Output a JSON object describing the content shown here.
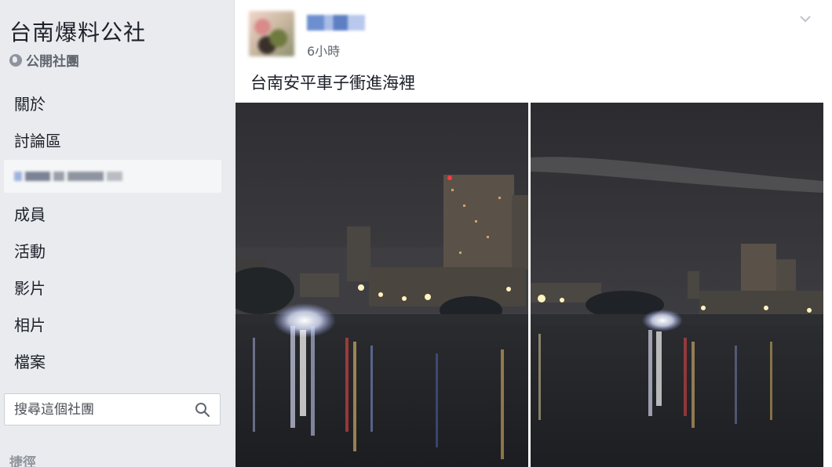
{
  "sidebar": {
    "group_name": "台南爆料公社",
    "privacy_label": "公開社團",
    "nav_items": [
      {
        "label": "關於"
      },
      {
        "label": "討論區"
      },
      {
        "label": ""
      },
      {
        "label": "成員"
      },
      {
        "label": "活動"
      },
      {
        "label": "影片"
      },
      {
        "label": "相片"
      },
      {
        "label": "檔案"
      }
    ],
    "search_placeholder": "搜尋這個社團",
    "shortcuts_label": "捷徑"
  },
  "post": {
    "timestamp": "6小時",
    "text": "台南安平車子衝進海裡"
  },
  "colors": {
    "background": "#e9ebee",
    "card": "#ffffff",
    "text": "#1d2129",
    "muted": "#616770",
    "night_sky": "#3b3b40",
    "water": "#23262b"
  },
  "icons": {
    "privacy": "globe-icon",
    "search": "search-icon",
    "menu": "chevron-down-icon"
  }
}
